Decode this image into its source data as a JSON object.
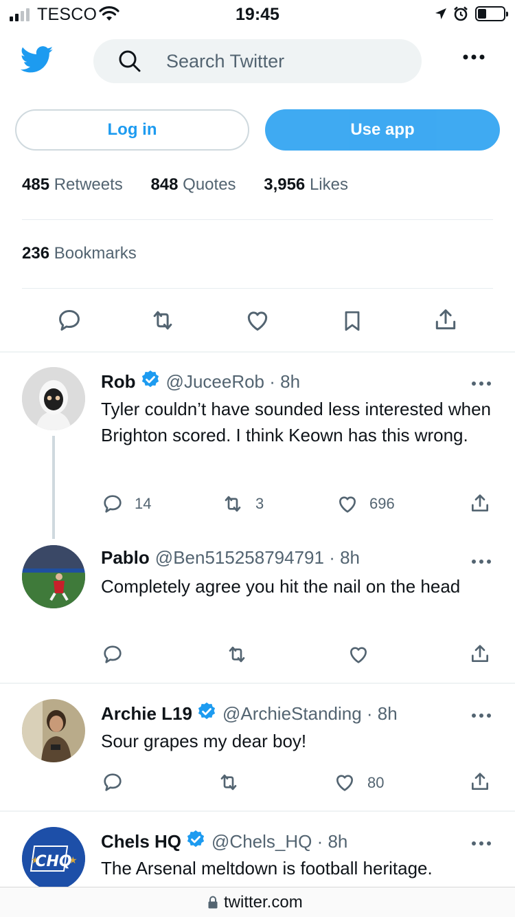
{
  "status_bar": {
    "carrier": "TESCO",
    "time": "19:45"
  },
  "search": {
    "placeholder": "Search Twitter"
  },
  "buttons": {
    "login": "Log in",
    "use_app": "Use app"
  },
  "stats": {
    "retweets_count": "485",
    "retweets_label": "Retweets",
    "quotes_count": "848",
    "quotes_label": "Quotes",
    "likes_count": "3,956",
    "likes_label": "Likes",
    "bookmarks_count": "236",
    "bookmarks_label": "Bookmarks"
  },
  "replies": [
    {
      "name": "Rob",
      "verified": true,
      "handle": "@JuceeRob · 8h",
      "text": "Tyler couldn’t have sounded less interested when Brighton scored. I think Keown has this wrong.",
      "reply_count": "14",
      "retweet_count": "3",
      "like_count": "696"
    },
    {
      "name": "Pablo",
      "verified": false,
      "handle": "@Ben515258794791 · 8h",
      "text": "Completely agree you hit the nail on the head",
      "reply_count": "",
      "retweet_count": "",
      "like_count": ""
    },
    {
      "name": "Archie L19",
      "verified": true,
      "handle": "@ArchieStanding · 8h",
      "text": "Sour grapes my dear boy!",
      "reply_count": "",
      "retweet_count": "",
      "like_count": "80"
    },
    {
      "name": "Chels HQ",
      "verified": true,
      "handle": "@Chels_HQ · 8h",
      "text": "The Arsenal meltdown is football heritage.",
      "avatar_text": "CHQ"
    }
  ],
  "browser": {
    "url": "twitter.com"
  },
  "colors": {
    "accent": "#1d9bf0",
    "secondary_text": "#536471"
  }
}
